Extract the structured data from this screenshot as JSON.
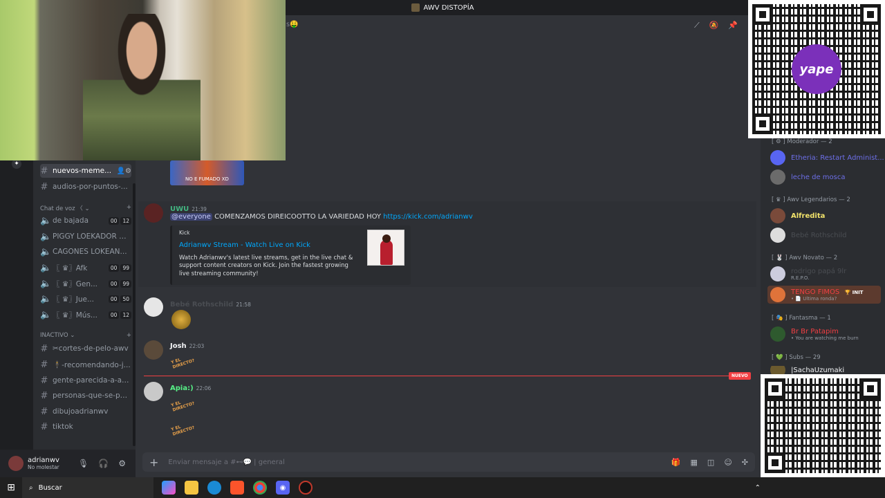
{
  "window": {
    "title": "AWV DISTOPÍA"
  },
  "header": {
    "channel_fragment": "s"
  },
  "sidebar": {
    "channels_top": [
      {
        "label": "nuevos-meme...",
        "active": true
      },
      {
        "label": "audios-por-puntos-..."
      }
    ],
    "voice_category": "Chat de voz 〈 ⌄",
    "voice_channels": [
      {
        "label": "de bajada",
        "a": "00",
        "b": "12"
      },
      {
        "label": "PIGGY LOEKADOR D..."
      },
      {
        "label": "CAGONES LOKEAN..."
      },
      {
        "label": "〖 ♛〗Afk",
        "a": "00",
        "b": "99"
      },
      {
        "label": "〖 ♛〗Gen...",
        "a": "00",
        "b": "99"
      },
      {
        "label": "〖 ♛〗Jue...",
        "a": "00",
        "b": "50"
      },
      {
        "label": "〖 ♛〗Mús...",
        "a": "00",
        "b": "12"
      }
    ],
    "inactive_category": "INACTIVO ⌄",
    "inactive_channels": [
      {
        "label": "✂cortes-de-pelo-awv"
      },
      {
        "label": "🕴-recomendando-j..."
      },
      {
        "label": "gente-parecida-a-ad..."
      },
      {
        "label": "personas-que-se-pa..."
      },
      {
        "label": "dibujoadrianwv"
      },
      {
        "label": "tiktok"
      }
    ]
  },
  "user": {
    "name": "adrianwv",
    "status": "No molestar"
  },
  "messages": {
    "image_caption": "NO E FUMADO XD",
    "m1": {
      "author": "UWU",
      "time": "21:39",
      "mention": "@everyone",
      "text": "COMENZAMOS DIREICOOTTO LA VARIEDAD HOY",
      "link": "https://kick.com/adrianwv",
      "embed": {
        "provider": "Kick",
        "title": "Adrianwv Stream - Watch Live on Kick",
        "desc": "Watch Adrianwv's latest live streams, get in the live chat & support content creators on Kick. Join the fastest growing live streaming community!"
      }
    },
    "m2": {
      "author": "Bebé Rothschild",
      "time": "21:58"
    },
    "m3": {
      "author": "Josh",
      "time": "22:03",
      "sticker": "Y EL DIRECTO?"
    },
    "new_badge": "NUEVO",
    "m4": {
      "author": "Apia:)",
      "time": "22:06",
      "sticker": "Y EL DIRECTO?"
    }
  },
  "composer": {
    "placeholder": "Enviar mensaje a #⊷💬 | general"
  },
  "members": {
    "groups": [
      {
        "label": "[ ⚙ ] Moderador — 2"
      },
      {
        "label": "[ ♛ ] Awv Legendarios — 2"
      },
      {
        "label": "[ 🐰 ] Awv Novato — 2"
      },
      {
        "label": "[ 🎭 ] Fantasma — 1"
      },
      {
        "label": "[ 💚 ] Subs — 29"
      }
    ],
    "items": [
      {
        "name": "Etheria: Restart Administ...",
        "color": "#6d6fe8",
        "sub": ""
      },
      {
        "name": "leche de mosca",
        "color": "#6d6fe8",
        "sub": ""
      },
      {
        "name": "Alfredita",
        "color": "#f2e36b",
        "sub": ""
      },
      {
        "name": "Bebé Rothschild",
        "color": "#4a4d52",
        "sub": ""
      },
      {
        "name": "rodrigo papá 9lr",
        "color": "#4a4d52",
        "sub": "R.E.P.O."
      },
      {
        "name": "TENGO FIMOS",
        "color": "#f23f43",
        "sub": "• 📄 Ultima ronda?",
        "badge": "🏆 INIT"
      },
      {
        "name": "Br Br Patapim",
        "color": "#f23f43",
        "sub": "• You are watching me burn"
      },
      {
        "name": "|SachaUzumaki",
        "color": "#f2f3f5",
        "sub": ""
      }
    ]
  },
  "overlay": {
    "yape_text": "yape"
  },
  "taskbar": {
    "search": "Buscar"
  }
}
